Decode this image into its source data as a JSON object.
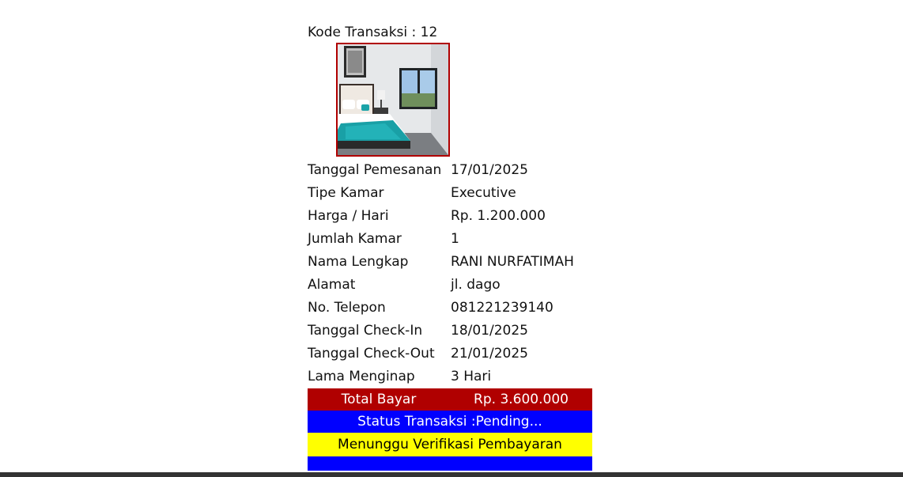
{
  "transaction": {
    "kode_label": "Kode Transaksi : 12"
  },
  "details": [
    {
      "label": "Tanggal Pemesanan",
      "value": "17/01/2025"
    },
    {
      "label": "Tipe Kamar",
      "value": "Executive"
    },
    {
      "label": "Harga / Hari",
      "value": "Rp. 1.200.000"
    },
    {
      "label": "Jumlah Kamar",
      "value": "1"
    },
    {
      "label": "Nama Lengkap",
      "value": "RANI NURFATIMAH"
    },
    {
      "label": "Alamat",
      "value": "jl. dago"
    },
    {
      "label": "No. Telepon",
      "value": "081221239140"
    },
    {
      "label": "Tanggal Check-In",
      "value": "18/01/2025"
    },
    {
      "label": "Tanggal Check-Out",
      "value": "21/01/2025"
    },
    {
      "label": "Lama Menginap",
      "value": "3 Hari"
    }
  ],
  "total": {
    "label": "Total Bayar",
    "value": "Rp. 3.600.000"
  },
  "status": {
    "text": "Status Transaksi :Pending..."
  },
  "verification": {
    "text": "Menunggu Verifikasi Pembayaran"
  },
  "colors": {
    "total_bar": "#b00000",
    "status_bar": "#0000ff",
    "verification_bar": "#ffff00",
    "photo_border": "#b00000"
  },
  "image": {
    "subject": "hotel-room-photo"
  }
}
